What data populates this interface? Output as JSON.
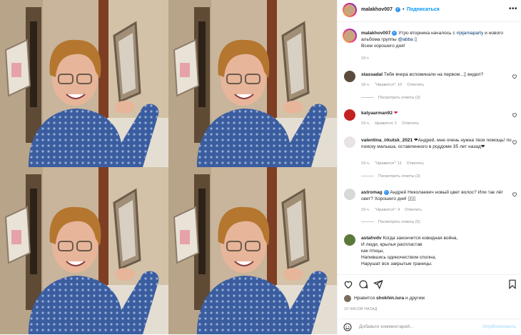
{
  "post": {
    "author": "malakhov007",
    "follow_label": "Подписаться",
    "caption_start": "Утро вторника началось с ",
    "caption_hashtag": "#pijamaparty",
    "caption_mid": " и нового альбома группы ",
    "caption_mention": "@abba",
    "caption_glyph": " ▯",
    "caption_end": "Всем хорошего дня!",
    "time": "19 ч"
  },
  "comments": [
    {
      "user": "stassadal",
      "text": "Тебя вчера вспоминали на первом...▯ видел?",
      "time": "18 ч.",
      "likes": "\"Нравится\": 10",
      "reply": "Ответить",
      "replies": "Посмотреть ответы (3)"
    },
    {
      "user": "katyaarman92",
      "text": "❤",
      "time": "19 ч.",
      "likes": "Нравится: 1",
      "reply": "Ответить"
    },
    {
      "user": "valentina_irkutsk_2021",
      "text": "❤Андрей, мне очень нужна твоя помощь! по поиску малыша, оставленного в роддоме 35 лет назад❤",
      "time": "19 ч.",
      "likes": "\"Нравится\": 11",
      "reply": "Ответить",
      "replies": "Посмотреть ответы (3)"
    },
    {
      "user": "astromag",
      "text": "Андрей Николаевич новый цвет волос? Или так лёг свет? Хорошего дня! ▯▯▯",
      "time": "19 ч.",
      "likes": "\"Нравится\": 4",
      "reply": "Ответить",
      "replies": "Посмотреть ответы (5)"
    },
    {
      "user": "astahvdv",
      "text_lines": [
        "Когда закончится ковидная война,",
        "И люди, крылья распластав",
        "как птицы,",
        "Напившись одиночеством сполна,",
        "Нарушат все закрытые границы."
      ]
    }
  ],
  "actions": {
    "likes_prefix": "Нравится ",
    "likes_user": "shokhin.iura",
    "likes_suffix": " и другим",
    "ago": "19 ЧАСОВ НАЗАД",
    "add_placeholder": "Добавьте комментарий...",
    "publish": "Опубликовать"
  },
  "icons": {
    "header_more": "more-horizontal-icon",
    "verified": "verified-badge-icon",
    "like": "heart-icon",
    "comment": "comment-icon",
    "share": "share-icon",
    "save": "bookmark-icon",
    "emoji": "emoji-icon"
  },
  "colors": {
    "link": "#0095f6",
    "hashtag": "#00376b",
    "muted": "#8e8e8e",
    "verified": "#3897f0"
  }
}
